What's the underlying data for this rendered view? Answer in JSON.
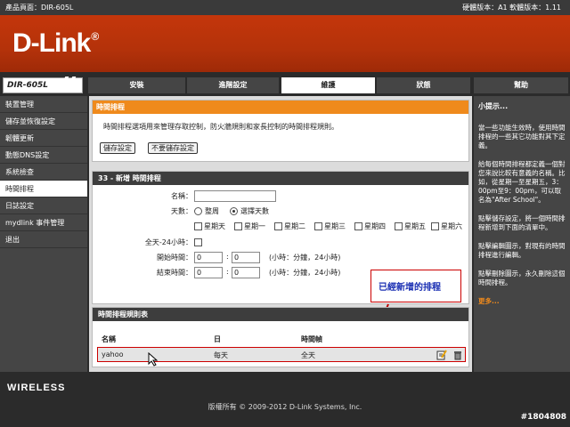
{
  "topbar": {
    "product": "產品頁面：DIR-605L",
    "versions": "硬體版本：A1  軟體版本：1.11"
  },
  "brand": {
    "logo": "D-Link",
    "model": "DIR-605L",
    "footer_brand": "WIRELESS"
  },
  "tabs": [
    {
      "label": "安裝"
    },
    {
      "label": "進階設定"
    },
    {
      "label": "維護"
    },
    {
      "label": "狀態"
    },
    {
      "label": "幫助"
    }
  ],
  "sidebar": {
    "items": [
      {
        "label": "裝置管理"
      },
      {
        "label": "儲存並恢復設定"
      },
      {
        "label": "韌體更新"
      },
      {
        "label": "動態DNS設定"
      },
      {
        "label": "系統檢查"
      },
      {
        "label": "時間排程"
      },
      {
        "label": "日誌設定"
      },
      {
        "label": "mydlink 事件管理"
      },
      {
        "label": "退出"
      }
    ]
  },
  "info": {
    "title": "時間排程",
    "desc": "時間排程選項用來管理存取控制，防火牆規則和家長控制的時間排程規則。",
    "save_label": "儲存設定",
    "nosave_label": "不要儲存設定"
  },
  "schedule": {
    "header": "33 - 新增 時間排程",
    "name_label": "名稱：",
    "name_value": "",
    "days_label": "天數：",
    "all_week": "整周",
    "select_days": "選擇天數",
    "days": [
      "星期天",
      "星期一",
      "星期二",
      "星期三",
      "星期四",
      "星期五",
      "星期六"
    ],
    "allday_label": "全天-24小時：",
    "start_label": "開始時間：",
    "end_label": "結束時間：",
    "start_h": "0",
    "start_m": "0",
    "end_h": "0",
    "end_m": "0",
    "time_hint": "(小時：分鐘，24小時)",
    "colon": ":"
  },
  "callout": {
    "text": "已經新增的排程"
  },
  "rules": {
    "header": "時間排程規則表",
    "col_name": "名稱",
    "col_day": "日",
    "col_time": "時間幀",
    "rows": [
      {
        "name": "yahoo",
        "day": "每天",
        "time": "全天"
      }
    ]
  },
  "help": {
    "title": "小提示...",
    "p1": "當一些功能生效時，使用時間排程的一些其它功能對其下定義。",
    "p2": "給每個時間排程都定義一個對您來說比較有意義的名稱。比如，從星期一至星期五，3：00pm至9：00pm，可以取名為\"After School\"。",
    "p3": "點擊儲存設定，將一個時間排程新增到下面的清單中。",
    "p4": "點擊編輯圖示，對現有的時間排程進行編輯。",
    "p5": "點擊刪除圖示，永久刪除這個時間排程。",
    "more": "更多..."
  },
  "footer": {
    "copyright": "版權所有 © 2009-2012 D-Link Systems, Inc.",
    "image_id": "#1804808"
  }
}
